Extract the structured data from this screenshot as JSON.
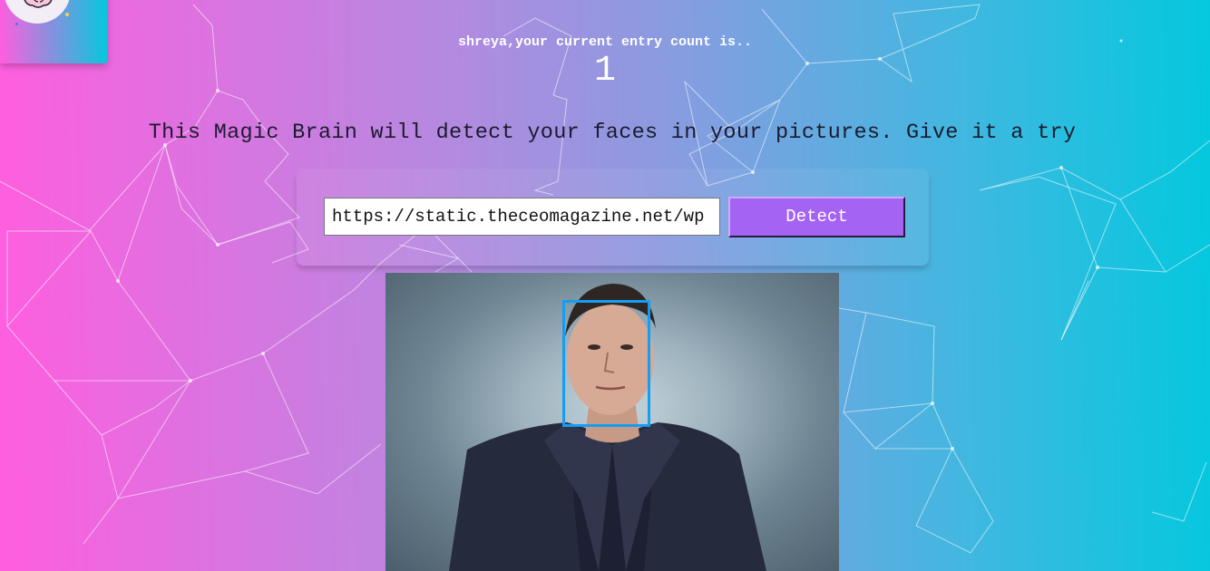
{
  "entry": {
    "greeting": "shreya,your current entry count is..",
    "count": "1"
  },
  "tagline": "This Magic Brain will detect your faces in your pictures. Give it a try",
  "form": {
    "url_value": "https://static.theceomagazine.net/wp",
    "detect_label": "Detect"
  },
  "icons": {
    "logo": "brain-icon"
  },
  "colors": {
    "gradient_left": "#ff5edf",
    "gradient_right": "#04c8de",
    "button": "#a463f2",
    "face_box": "#149df2"
  }
}
